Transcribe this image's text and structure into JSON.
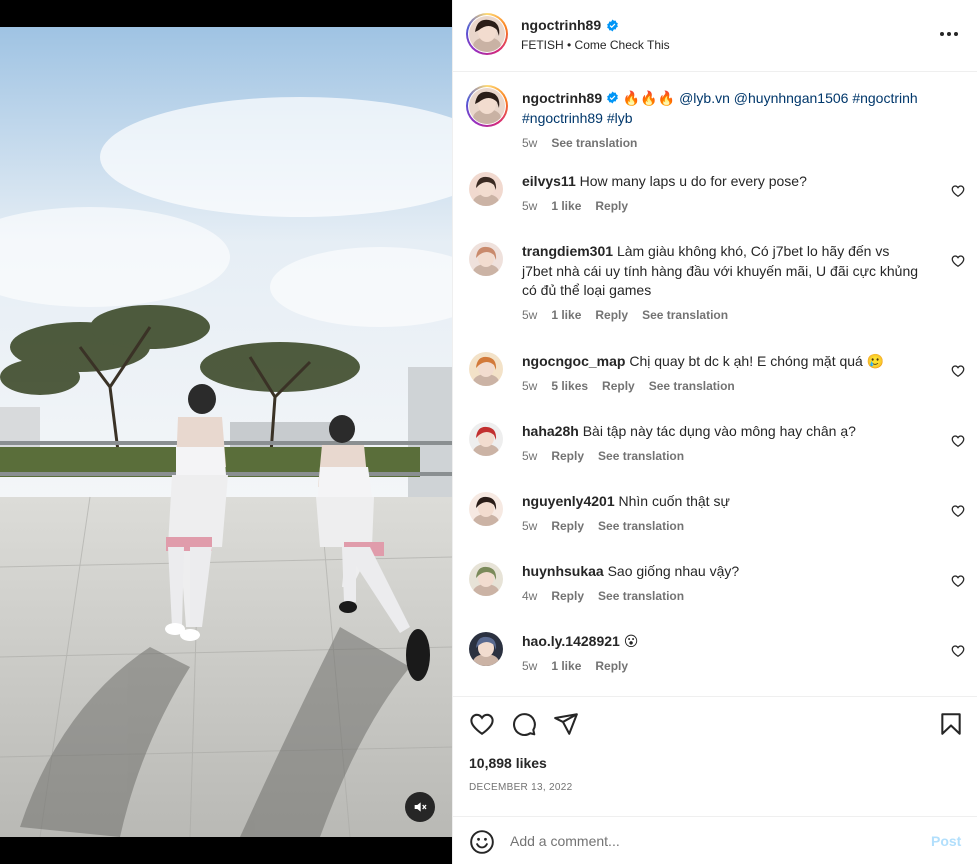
{
  "post": {
    "username": "ngoctrinh89",
    "audio": "FETISH • Come Check This",
    "more_icon": "more-horizontal-icon"
  },
  "caption": {
    "username": "ngoctrinh89",
    "fire": "🔥🔥🔥",
    "mention1": "@lyb.vn",
    "mention2": "@huynhngan1506",
    "tag1": "#ngoctrinh",
    "tag2": "#ngoctrinh89",
    "tag3": "#lyb",
    "time": "5w",
    "translate": "See translation"
  },
  "comments": [
    {
      "user": "eilvys11",
      "text": "How many laps u do for every pose?",
      "time": "5w",
      "likes": "1 like",
      "reply": "Reply",
      "translate": ""
    },
    {
      "user": "trangdiem301",
      "text": "Làm giàu không khó, Có j7bet lo hãy đến vs j7bet nhà cái uy tính hàng đầu với khuyến mãi, U đãi cực khủng có đủ thể loại games",
      "time": "5w",
      "likes": "1 like",
      "reply": "Reply",
      "translate": "See translation"
    },
    {
      "user": "ngocngoc_map",
      "text": "Chị quay bt dc k ạh! E chóng mặt quá 🥲",
      "time": "5w",
      "likes": "5 likes",
      "reply": "Reply",
      "translate": "See translation"
    },
    {
      "user": "haha28h",
      "text": "Bài tập này tác dụng vào mông hay chân ạ?",
      "time": "5w",
      "likes": "",
      "reply": "Reply",
      "translate": "See translation"
    },
    {
      "user": "nguyenly4201",
      "text": "Nhìn cuốn thật sự",
      "time": "5w",
      "likes": "",
      "reply": "Reply",
      "translate": "See translation"
    },
    {
      "user": "huynhsukaa",
      "text": "Sao giống nhau vậy?",
      "time": "4w",
      "likes": "",
      "reply": "Reply",
      "translate": "See translation"
    },
    {
      "user": "hao.ly.1428921",
      "text": "😮",
      "time": "5w",
      "likes": "1 like",
      "reply": "Reply",
      "translate": ""
    }
  ],
  "footer": {
    "likes": "10,898 likes",
    "date": "DECEMBER 13, 2022",
    "placeholder": "Add a comment...",
    "post_label": "Post"
  },
  "colors": {
    "link": "#00376b",
    "muted": "#737373",
    "verified": "#0095f6",
    "post_disabled": "#b2dffc"
  }
}
